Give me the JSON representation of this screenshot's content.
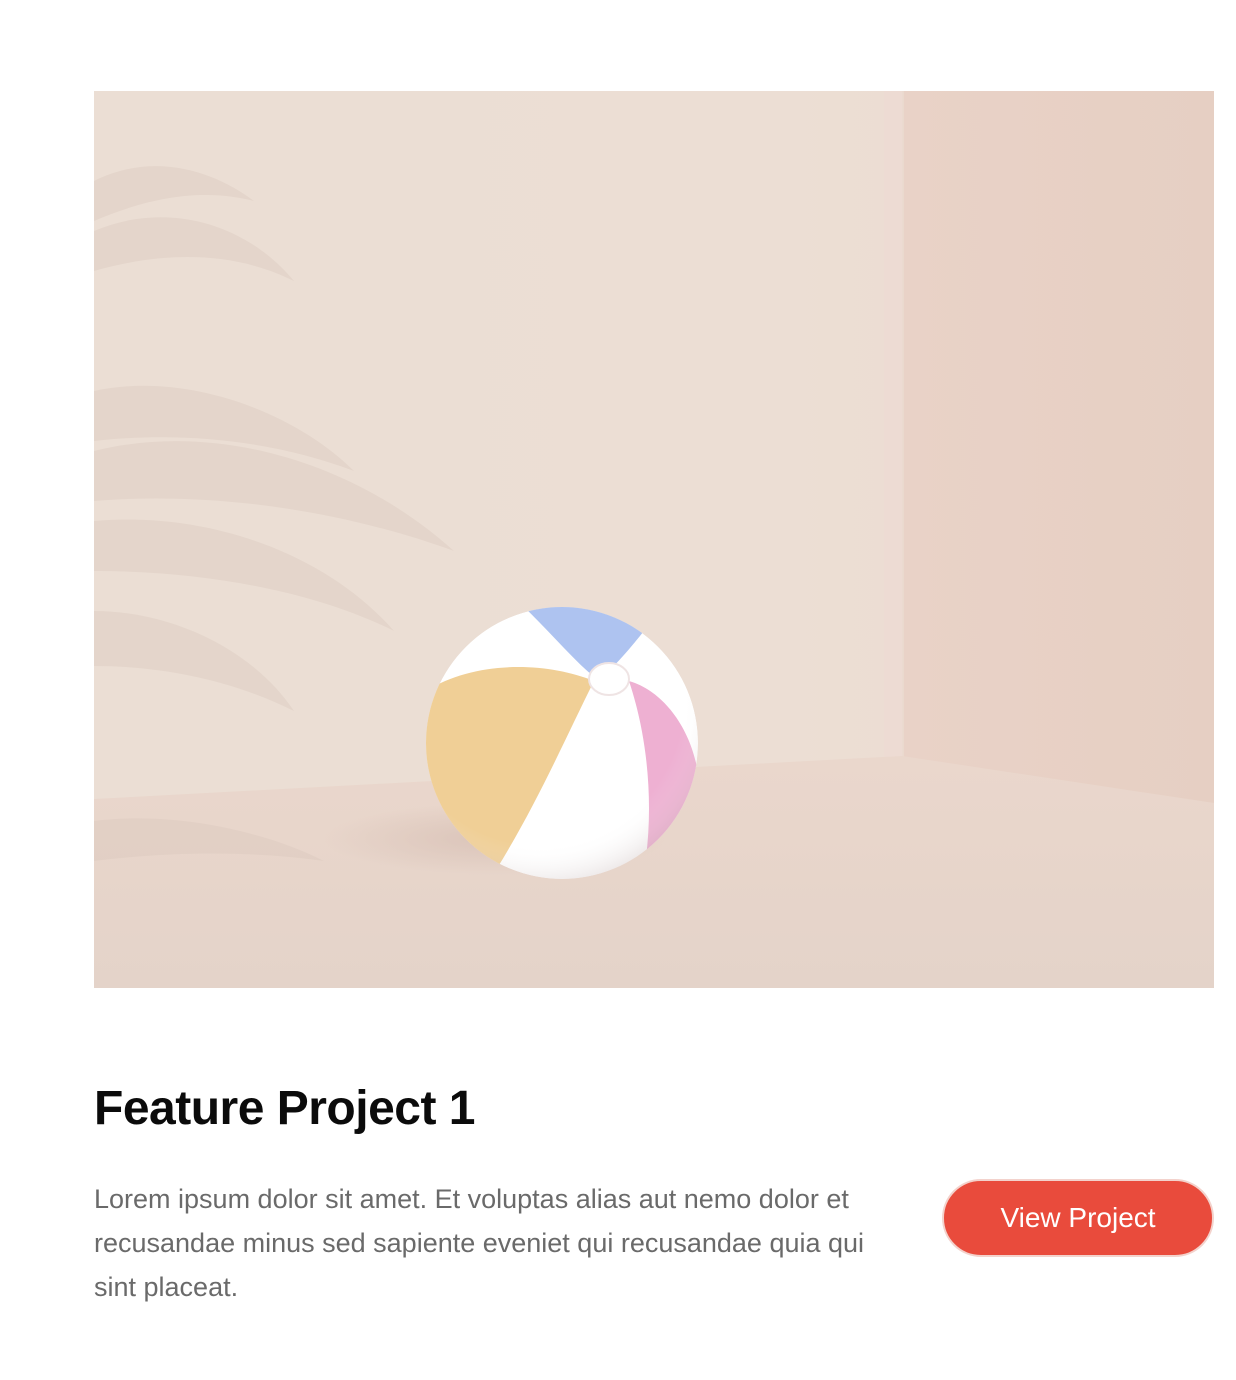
{
  "project": {
    "title": "Feature Project 1",
    "description": "Lorem ipsum dolor sit amet. Et voluptas alias aut nemo dolor et recusandae minus sed sapiente eveniet qui recusandae quia qui sint placeat.",
    "button_label": "View Project"
  },
  "image": {
    "subject": "beach-ball",
    "accent_colors": {
      "ball_yellow": "#f0cf96",
      "ball_blue": "#aec3f0",
      "ball_pink": "#eeb0d2",
      "ball_white": "#ffffff",
      "wall": "#ecddd3"
    }
  },
  "colors": {
    "button_bg": "#e94b3c",
    "title_text": "#0b0b0b",
    "body_text": "#6a6a6a"
  }
}
